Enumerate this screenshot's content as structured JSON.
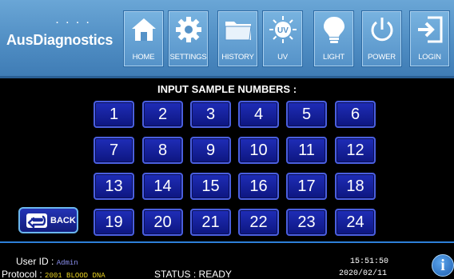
{
  "header": {
    "logo_text": "AusDiagnostics",
    "logo_dots": "· · · ·",
    "buttons": [
      {
        "label": "HOME",
        "icon": "home-icon"
      },
      {
        "label": "SETTINGS",
        "icon": "gear-icon"
      },
      {
        "label": "HISTORY",
        "icon": "folder-icon"
      },
      {
        "label": "UV",
        "icon": "uv-sun-icon"
      },
      {
        "label": "LIGHT",
        "icon": "lightbulb-icon"
      },
      {
        "label": "POWER",
        "icon": "power-icon"
      },
      {
        "label": "LOGIN",
        "icon": "login-icon"
      }
    ],
    "uv_icon_text": "UV"
  },
  "main": {
    "prompt": "INPUT SAMPLE NUMBERS :",
    "keys": [
      "1",
      "2",
      "3",
      "4",
      "5",
      "6",
      "7",
      "8",
      "9",
      "10",
      "11",
      "12",
      "13",
      "14",
      "15",
      "16",
      "17",
      "18",
      "19",
      "20",
      "21",
      "22",
      "23",
      "24"
    ],
    "back_label": "BACK"
  },
  "footer": {
    "user_label": "User ID :",
    "user_value": "Admin",
    "protocol_label": "Protocol :",
    "protocol_value": "2001 BLOOD DNA",
    "status": "STATUS : READY",
    "time": "15:51:50",
    "date": "2020/02/11",
    "info_glyph": "i"
  },
  "colors": {
    "header_blue": "#4e8cc2",
    "key_blue": "#1f2db8",
    "accent_line": "#2d7fd8",
    "protocol_yellow": "#e6d020",
    "user_purple": "#8a8ff0"
  }
}
